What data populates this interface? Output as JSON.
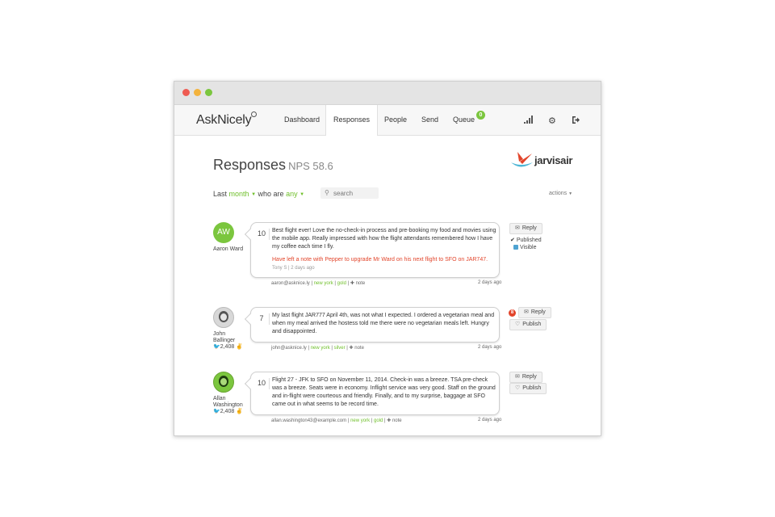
{
  "app": {
    "logo": "AskNicely",
    "nav": [
      {
        "label": "Dashboard"
      },
      {
        "label": "Responses"
      },
      {
        "label": "People"
      },
      {
        "label": "Send"
      },
      {
        "label": "Queue"
      }
    ],
    "queue_count": "0"
  },
  "page": {
    "title": "Responses",
    "nps_label": "NPS 58.6",
    "brand": "jarvisair",
    "filters": {
      "last": "Last",
      "period": "month",
      "who_are": "who are",
      "segment": "any"
    },
    "search_placeholder": "search",
    "actions_label": "actions"
  },
  "responses": [
    {
      "initials": "AW",
      "name": "Aaron Ward",
      "score": "10",
      "comment": "Best flight ever! Love the no-check-in process and pre-booking my food and movies using the mobile app. Really impressed with how the flight attendants remembered how I have my coffee each time I fly.",
      "note": "Have left a note with Pepper to upgrade Mr Ward on his next flight to SFO on JAR747.",
      "note_meta": "Tony S | 2 days ago",
      "email": "aaron@asknice.ly",
      "tag1": "new york",
      "tag2": "gold",
      "note_link": "note",
      "time": "2 days ago",
      "reply_label": "Reply",
      "published_label": "Published",
      "visible_label": "Visible"
    },
    {
      "name": "John Ballinger",
      "followers": "2,408",
      "score": "7",
      "comment": "My last flight JAR777 April 4th, was not what I expected. I ordered a vegetarian meal and when my meal arrived the hostess told me there were no vegetarian meals left. Hungry and disappointed.",
      "email": "john@asknice.ly",
      "tag1": "new york",
      "tag2": "silver",
      "note_link": "note",
      "time": "2 days ago",
      "alert_count": "8",
      "reply_label": "Reply",
      "publish_label": "Publish"
    },
    {
      "name": "Allan Washington",
      "followers": "2,408",
      "score": "10",
      "comment": "Flight 27 - JFK to SFO on November 11, 2014. Check-in was a breeze. TSA pre-check was a breeze. Seats were in economy. Inflight service was very good. Staff on the ground and in-flight were courteous and friendly. Finally, and to my surprise, baggage at SFO came out in what seems to be record time.",
      "email": "allan.washington43@example.com",
      "tag1": "new york",
      "tag2": "gold",
      "note_link": "note",
      "time": "2 days ago",
      "reply_label": "Reply",
      "publish_label": "Publish"
    }
  ],
  "colors": {
    "accent_green": "#7bc63e",
    "note_red": "#e2452b",
    "visible_blue": "#4fa3d1"
  }
}
